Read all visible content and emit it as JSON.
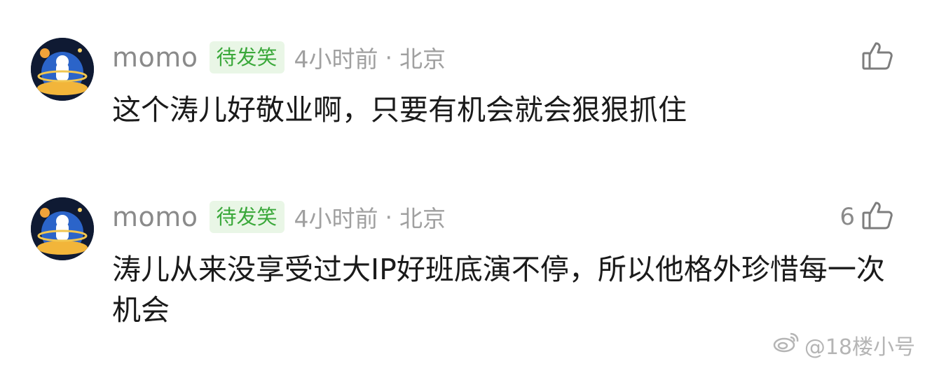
{
  "comments": [
    {
      "username": "momo",
      "badge": "待发笑",
      "time": "4小时前",
      "separator": "·",
      "location": "北京",
      "likes": "",
      "text": "这个涛儿好敬业啊，只要有机会就会狠狠抓住"
    },
    {
      "username": "momo",
      "badge": "待发笑",
      "time": "4小时前",
      "separator": "·",
      "location": "北京",
      "likes": "6",
      "text": "涛儿从来没享受过大IP好班底演不停，所以他格外珍惜每一次机会"
    }
  ],
  "watermark": {
    "text": "@18楼小号",
    "icon": "weibo-icon"
  },
  "colors": {
    "badge_bg": "#e9f6e6",
    "badge_text": "#3aa83a",
    "meta_text": "#a0a0a0",
    "body_text": "#1a1a1a"
  }
}
